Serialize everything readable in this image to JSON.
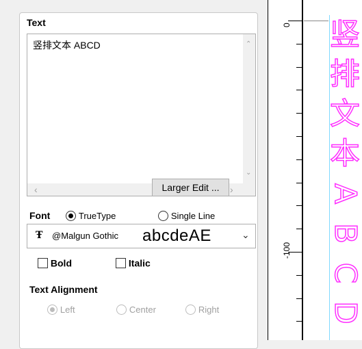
{
  "text_section": {
    "title": "Text",
    "content": "竖排文本 ABCD",
    "larger_edit_label": "Larger Edit ..."
  },
  "font": {
    "label": "Font",
    "option_truetype": "TrueType",
    "option_single_line": "Single Line",
    "selected_font": "@Malgun Gothic",
    "preview": "abcdeAE"
  },
  "style": {
    "bold_label": "Bold",
    "italic_label": "Italic"
  },
  "alignment": {
    "title": "Text Alignment",
    "left": "Left",
    "center": "Center",
    "right": "Right"
  },
  "ruler": {
    "label_0": "0",
    "label_100": "-100"
  },
  "canvas": {
    "vertical_text_chars": [
      "竖",
      "排",
      "文",
      "本",
      "A",
      "B",
      "C",
      "D"
    ],
    "text_color": "#ff2dff"
  }
}
